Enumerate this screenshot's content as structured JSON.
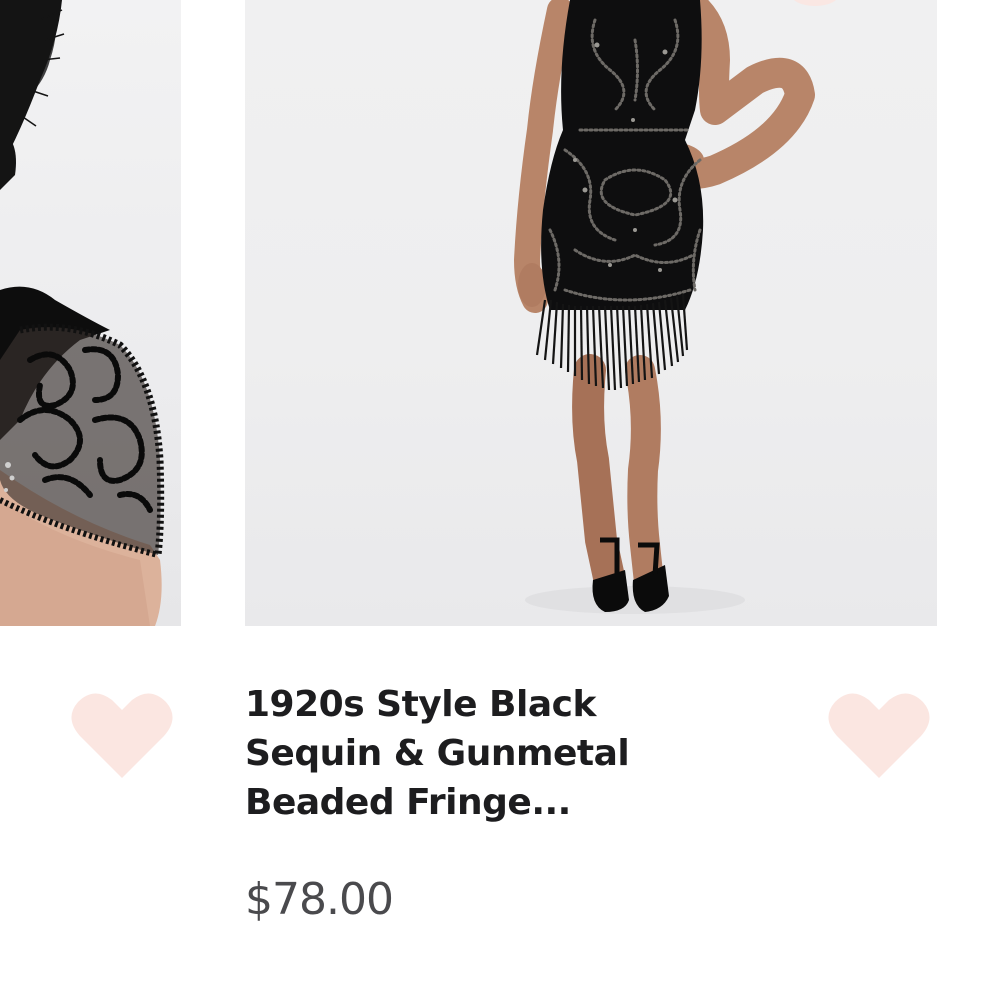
{
  "product": {
    "title_lines": [
      "1920s Style Black",
      "Sequin & Gunmetal",
      "Beaded Fringe..."
    ],
    "price": "$78.00"
  },
  "icons": {
    "favorite_left": "heart-icon",
    "favorite_right": "heart-icon"
  },
  "colors": {
    "heart_fill": "#fbe6e1",
    "title_text": "#1d1d1f",
    "price_text": "#4a4a4d",
    "image_background": "#eeeeef"
  }
}
